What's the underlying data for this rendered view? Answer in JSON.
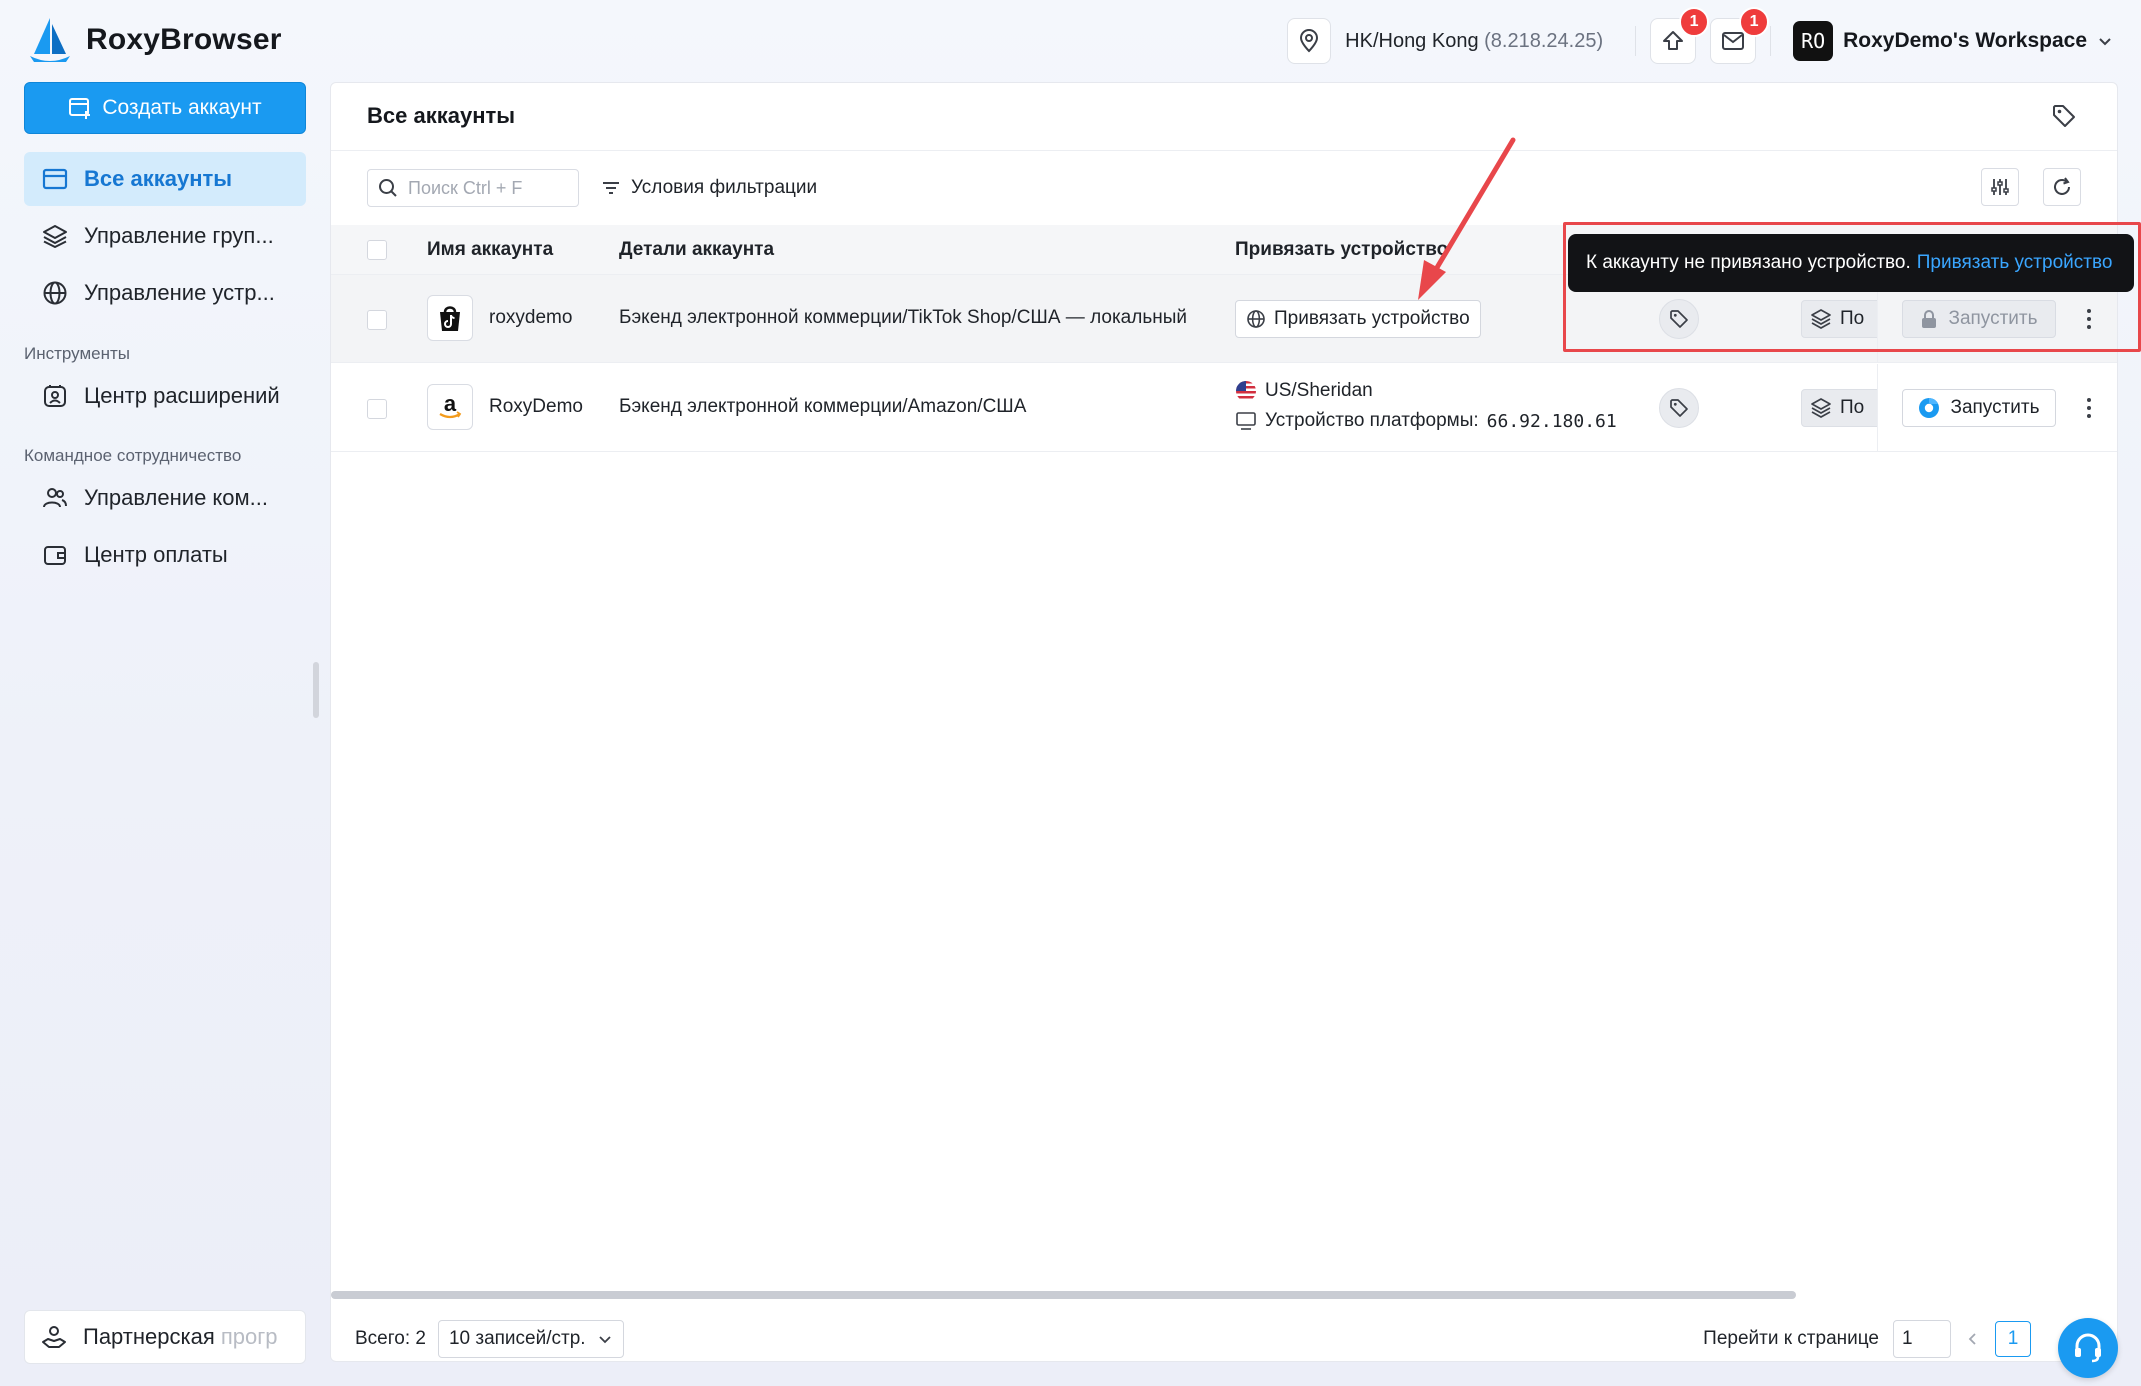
{
  "app": {
    "name": "RoxyBrowser"
  },
  "topbar": {
    "location": "HK/Hong Kong",
    "ip": "(8.218.24.25)",
    "upload_badge": "1",
    "mail_badge": "1",
    "workspace_avatar": "RO",
    "workspace_name": "RoxyDemo's Workspace"
  },
  "sidebar": {
    "create_button": "Создать аккаунт",
    "items": [
      {
        "label": "Все аккаунты",
        "icon": "browser-window-icon",
        "active": true
      },
      {
        "label": "Управление груп...",
        "icon": "layers-icon"
      },
      {
        "label": "Управление устр...",
        "icon": "globe-icon"
      }
    ],
    "tools_section": "Инструменты",
    "tools_items": [
      {
        "label": "Центр расширений",
        "icon": "extension-icon"
      }
    ],
    "team_section": "Командное сотрудничество",
    "team_items": [
      {
        "label": "Управление ком...",
        "icon": "team-icon"
      },
      {
        "label": "Центр оплаты",
        "icon": "wallet-icon"
      }
    ],
    "partner": {
      "label": "Партнерская ",
      "label_fade": "прогр"
    }
  },
  "main": {
    "title": "Все аккаунты",
    "search_placeholder": "Поиск Ctrl + F",
    "filter_label": "Условия фильтрации",
    "columns": {
      "name": "Имя аккаунта",
      "details": "Детали аккаунта",
      "bind_device": "Привязать устройство"
    },
    "rows": [
      {
        "platform_icon": "tiktok-shop-icon",
        "name": "roxydemo",
        "details": "Бэкенд электронной коммерции/TikTok Shop/США — локальный",
        "bind_button": "Привязать устройство",
        "group_chip": "По",
        "launch": "Запустить",
        "launch_state": "disabled"
      },
      {
        "platform_icon": "amazon-icon",
        "name": "RoxyDemo",
        "details": "Бэкенд электронной коммерции/Amazon/США",
        "device_location": "US/Sheridan",
        "device_label": "Устройство платформы:",
        "device_ip": "66.92.180.61",
        "group_chip": "По",
        "launch": "Запустить",
        "launch_state": "enabled"
      }
    ],
    "tooltip": {
      "text": "К аккаунту не привязано устройство.",
      "link": "Привязать устройство"
    }
  },
  "footer": {
    "total": "Всего: 2",
    "page_size": "10 записей/стр.",
    "goto_label": "Перейти к странице",
    "goto_value": "1",
    "current_page": "1"
  },
  "colors": {
    "accent": "#1a9af1",
    "active_nav_bg": "#d3ebfc",
    "badge": "#ef3c3c",
    "annotation": "#e8474b"
  }
}
